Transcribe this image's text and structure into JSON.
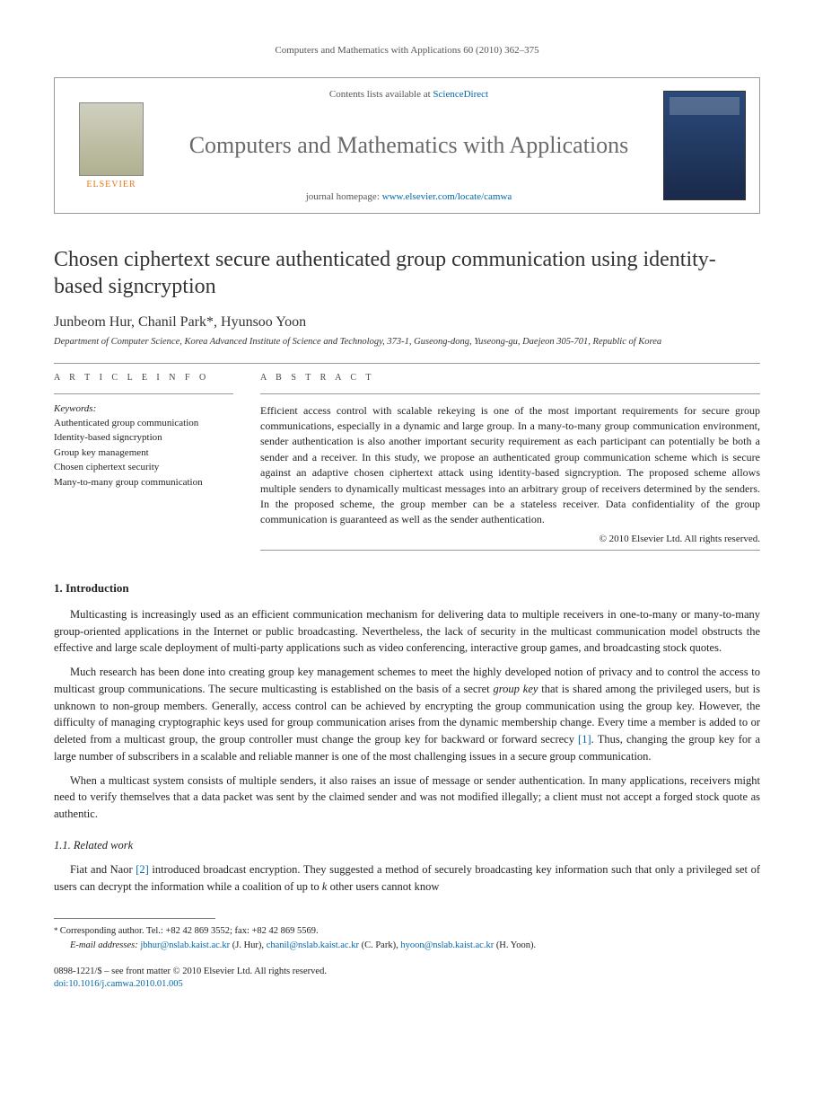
{
  "running_header": "Computers and Mathematics with Applications 60 (2010) 362–375",
  "banner": {
    "contents_prefix": "Contents lists available at ",
    "sciencedirect": "ScienceDirect",
    "journal_name": "Computers and Mathematics with Applications",
    "homepage_prefix": "journal homepage: ",
    "homepage_url": "www.elsevier.com/locate/camwa",
    "elsevier": "ELSEVIER"
  },
  "title": "Chosen ciphertext secure authenticated group communication using identity-based signcryption",
  "authors": "Junbeom Hur, Chanil Park*, Hyunsoo Yoon",
  "affiliation": "Department of Computer Science, Korea Advanced Institute of Science and Technology, 373-1, Guseong-dong, Yuseong-gu, Daejeon 305-701, Republic of Korea",
  "article_info_heading": "A R T I C L E   I N F O",
  "abstract_heading": "A B S T R A C T",
  "keywords_label": "Keywords:",
  "keywords": [
    "Authenticated group communication",
    "Identity-based signcryption",
    "Group key management",
    "Chosen ciphertext security",
    "Many-to-many group communication"
  ],
  "abstract": "Efficient access control with scalable rekeying is one of the most important requirements for secure group communications, especially in a dynamic and large group. In a many-to-many group communication environment, sender authentication is also another important security requirement as each participant can potentially be both a sender and a receiver. In this study, we propose an authenticated group communication scheme which is secure against an adaptive chosen ciphertext attack using identity-based signcryption. The proposed scheme allows multiple senders to dynamically multicast messages into an arbitrary group of receivers determined by the senders. In the proposed scheme, the group member can be a stateless receiver. Data confidentiality of the group communication is guaranteed as well as the sender authentication.",
  "copyright": "© 2010 Elsevier Ltd. All rights reserved.",
  "sections": {
    "s1_heading": "1.  Introduction",
    "s1_p1": "Multicasting is increasingly used as an efficient communication mechanism for delivering data to multiple receivers in one-to-many or many-to-many group-oriented applications in the Internet or public broadcasting. Nevertheless, the lack of security in the multicast communication model obstructs the effective and large scale deployment of multi-party applications such as video conferencing, interactive group games, and broadcasting stock quotes.",
    "s1_p2_a": "Much research has been done into creating group key management schemes to meet the highly developed notion of privacy and to control the access to multicast group communications. The secure multicasting is established on the basis of a secret ",
    "s1_p2_groupkey": "group key",
    "s1_p2_b": " that is shared among the privileged users, but is unknown to non-group members. Generally, access control can be achieved by encrypting the group communication using the group key. However, the difficulty of managing cryptographic keys used for group communication arises from the dynamic membership change. Every time a member is added to or deleted from a multicast group, the group controller must change the group key for backward or forward secrecy ",
    "s1_p2_ref": "[1]",
    "s1_p2_c": ". Thus, changing the group key for a large number of subscribers in a scalable and reliable manner is one of the most challenging issues in a secure group communication.",
    "s1_p3": "When a multicast system consists of multiple senders, it also raises an issue of message or sender authentication. In many applications, receivers might need to verify themselves that a data packet was sent by the claimed sender and was not modified illegally; a client must not accept a forged stock quote as authentic.",
    "s11_heading": "1.1.  Related work",
    "s11_p1_a": "Fiat and Naor ",
    "s11_p1_ref": "[2]",
    "s11_p1_b": " introduced broadcast encryption. They suggested a method of securely broadcasting key information such that only a privileged set of users can decrypt the information while a coalition of up to ",
    "s11_p1_k": "k",
    "s11_p1_c": " other users cannot know"
  },
  "footnotes": {
    "corr": "Corresponding author. Tel.: +82 42 869 3552; fax: +82 42 869 5569.",
    "email_label": "E-mail addresses:",
    "emails": [
      {
        "addr": "jbhur@nslab.kaist.ac.kr",
        "who": " (J. Hur), "
      },
      {
        "addr": "chanil@nslab.kaist.ac.kr",
        "who": " (C. Park), "
      },
      {
        "addr": "hyoon@nslab.kaist.ac.kr",
        "who": " (H. Yoon)."
      }
    ]
  },
  "bottom": {
    "issn": "0898-1221/$ – see front matter © 2010 Elsevier Ltd. All rights reserved.",
    "doi": "doi:10.1016/j.camwa.2010.01.005"
  }
}
